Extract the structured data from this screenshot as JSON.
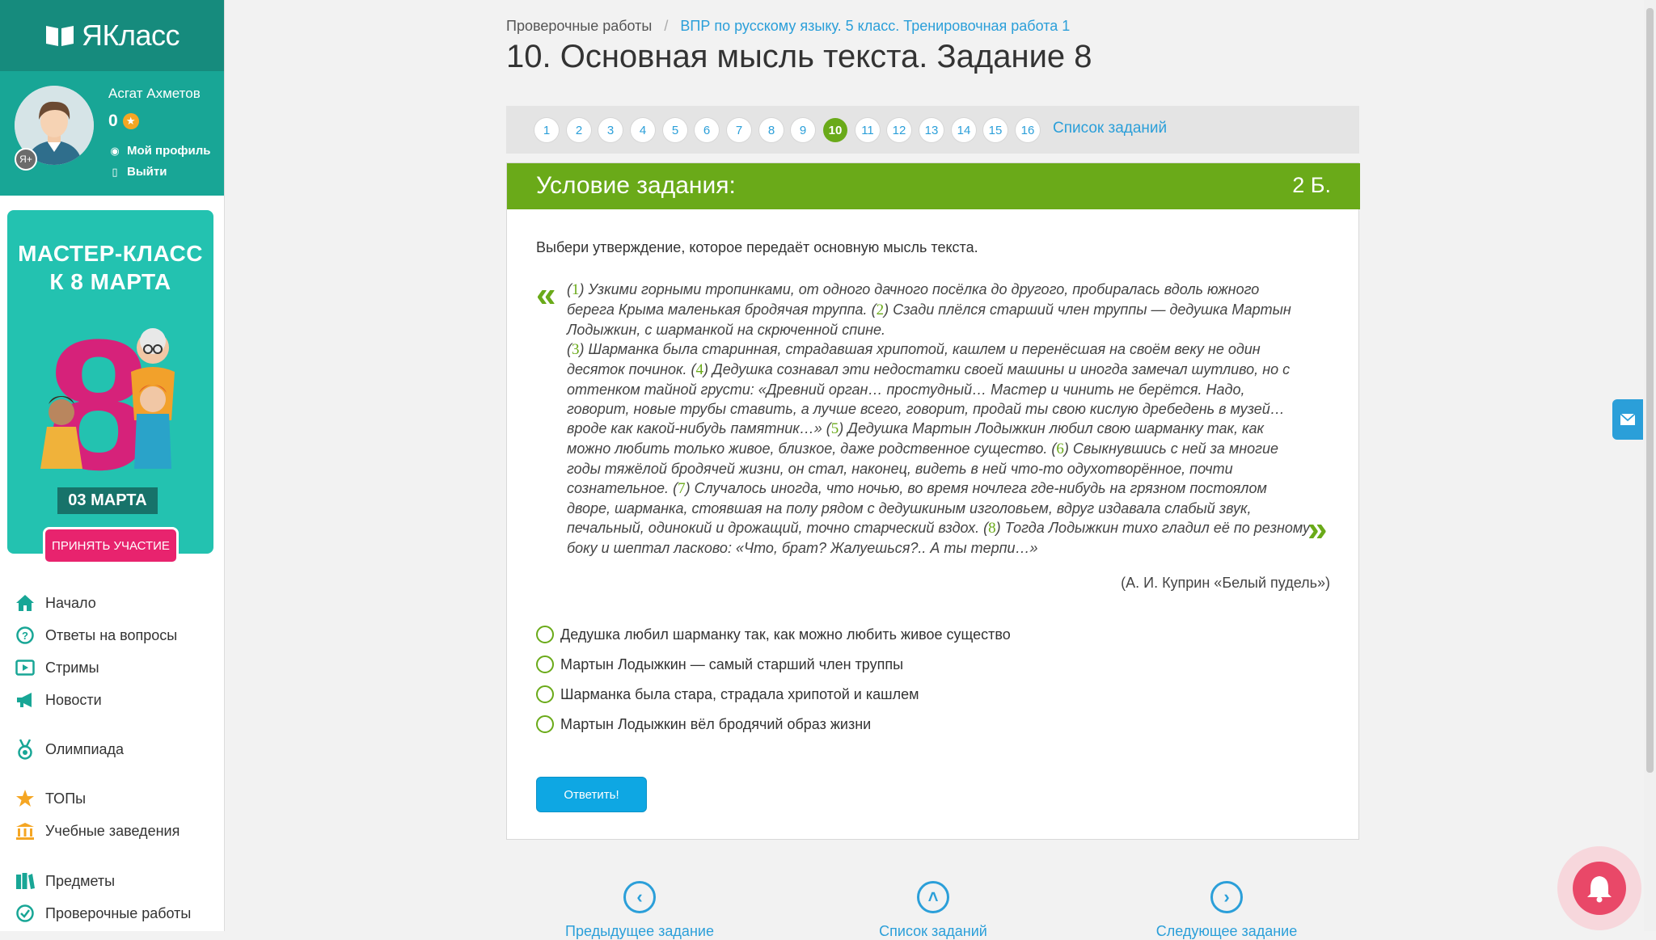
{
  "brand": {
    "name": "ЯКласс"
  },
  "user": {
    "name": "Асгат Ахметов",
    "score": "0",
    "badge": "Я+",
    "profile_link": "Мой профиль",
    "logout_link": "Выйти"
  },
  "promo": {
    "title_line1": "МАСТЕР-КЛАСС",
    "title_line2": "К 8 МАРТА",
    "big_number": "8",
    "date": "03 МАРТА",
    "button": "ПРИНЯТЬ УЧАСТИЕ"
  },
  "nav": {
    "items": [
      {
        "label": "Начало",
        "icon": "home-icon"
      },
      {
        "label": "Ответы на вопросы",
        "icon": "question-icon"
      },
      {
        "label": "Стримы",
        "icon": "play-icon"
      },
      {
        "label": "Новости",
        "icon": "megaphone-icon"
      },
      {
        "label": "Олимпиада",
        "icon": "medal-icon"
      },
      {
        "label": "ТОПы",
        "icon": "star-icon"
      },
      {
        "label": "Учебные заведения",
        "icon": "building-icon"
      },
      {
        "label": "Предметы",
        "icon": "books-icon"
      },
      {
        "label": "Проверочные работы",
        "icon": "check-icon"
      }
    ]
  },
  "breadcrumb": {
    "root": "Проверочные работы",
    "separator": "/",
    "current": "ВПР по русскому языку. 5 класс. Тренировочная работа 1"
  },
  "page": {
    "title": "10. Основная мысль текста. Задание 8"
  },
  "task_nav": {
    "numbers": [
      "1",
      "2",
      "3",
      "4",
      "5",
      "6",
      "7",
      "8",
      "9",
      "10",
      "11",
      "12",
      "13",
      "14",
      "15",
      "16"
    ],
    "active": "10",
    "list_link": "Список заданий"
  },
  "task": {
    "header": "Условие задания:",
    "points": "2 Б.",
    "question": "Выбери утверждение, которое передаёт основную мысль текста.",
    "quote_open": "«",
    "quote_close": "»",
    "passage": [
      {
        "n": "1",
        "text": "Узкими горными тропинками, от одного дачного посёлка до другого, пробиралась вдоль южного берега Крыма маленькая бродячая труппа."
      },
      {
        "n": "2",
        "text": "Сзади плёлся старший член труппы — дедушка Мартын Лодыжкин, с шарманкой на скрюченной спине."
      },
      {
        "n": "3",
        "text": "Шарманка была старинная, страдавшая хрипотой, кашлем и перенёсшая на своём веку не один десяток починок."
      },
      {
        "n": "4",
        "text": "Дедушка сознавал эти недостатки своей машины и иногда замечал шутливо, но с оттенком тайной грусти: «Древний орган… простудный… Мастер и чинить не берётся. Надо, говорит, новые трубы ставить, а лучше всего, говорит, продай ты свою кислую дребедень в музей… вроде как какой-нибудь памятник…»"
      },
      {
        "n": "5",
        "text": "Дедушка Мартын Лодыжкин любил свою шарманку так, как можно любить только живое, близкое, даже родственное существо."
      },
      {
        "n": "6",
        "text": "Свыкнувшись с ней за многие годы тяжёлой бродячей жизни, он стал, наконец, видеть в ней что-то одухотворённое, почти сознательное."
      },
      {
        "n": "7",
        "text": "Случалось иногда, что ночью, во время ночлега где-нибудь на грязном постоялом дворе, шарманка, стоявшая на полу рядом с дедушкиным изголовьем, вдруг издавала слабый звук, печальный, одинокий и дрожащий, точно старческий вздох."
      },
      {
        "n": "8",
        "text": "Тогда Лодыжкин тихо гладил её по резному боку и шептал ласково: «Что, брат? Жалуешься?.. А ты терпи…»"
      }
    ],
    "attribution": "(А. И. Куприн «Белый пудель»)",
    "options": [
      "Дедушка любил шарманку так, как можно любить живое существо",
      "Мартын Лодыжкин — самый старший член труппы",
      "Шарманка была стара, страдала хрипотой и кашлем",
      "Мартын Лодыжкин вёл бродячий образ жизни"
    ],
    "submit": "Ответить!"
  },
  "bottom_nav": {
    "prev": "Предыдущее задание",
    "list": "Список заданий",
    "next": "Следующее задание"
  },
  "colors": {
    "accent_green": "#6aaa19",
    "link_blue": "#2b9fd9",
    "sidebar_teal": "#18a696",
    "button_blue": "#0ea7e3"
  }
}
